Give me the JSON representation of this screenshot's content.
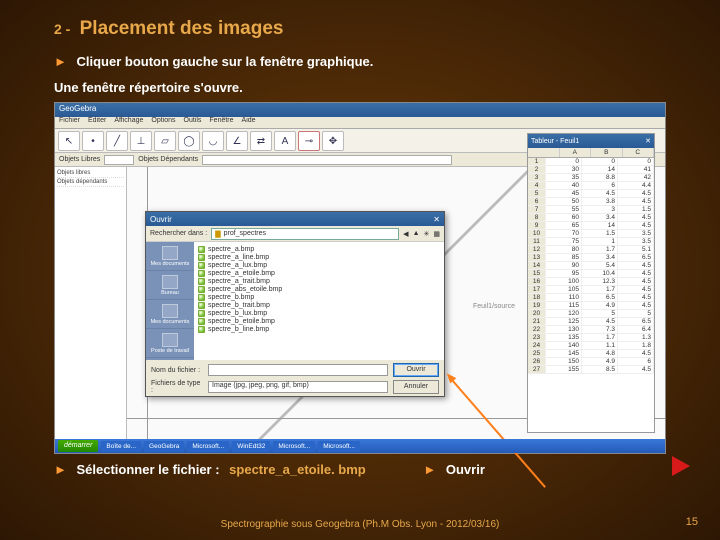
{
  "title": {
    "num": "2 -",
    "text": "Placement des images"
  },
  "bullets": {
    "b1": "Cliquer bouton gauche sur la fenêtre graphique.",
    "b2": "Une fenêtre répertoire s'ouvre."
  },
  "app": {
    "winTitle": "GeoGebra",
    "menus": [
      "Fichier",
      "Éditer",
      "Affichage",
      "Options",
      "Outils",
      "Fenêtre",
      "Aide"
    ],
    "fieldLabel1": "Objets Libres",
    "fieldLabel2": "Objets Dépendants",
    "leftList": [
      "Objets libres",
      "Objets dépendants"
    ],
    "fileCaption": "Feuil1/source"
  },
  "dialog": {
    "title": "Ouvrir",
    "locLabel": "Rechercher dans :",
    "locValue": "prof_spectres",
    "places": [
      "Mes documents",
      "Bureau",
      "Mes documents",
      "Poste de travail"
    ],
    "files": [
      "spectre_a.bmp",
      "spectre_a_line.bmp",
      "spectre_a_lux.bmp",
      "spectre_a_etoile.bmp",
      "spectre_a_trait.bmp",
      "spectre_abs_etoile.bmp",
      "spectre_b.bmp",
      "spectre_b_trait.bmp",
      "spectre_b_lux.bmp",
      "spectre_b_etoile.bmp",
      "spectre_b_line.bmp"
    ],
    "nameLabel": "Nom du fichier :",
    "typeLabel": "Fichiers de type :",
    "typeValue": "Image (jpg, jpeg, png, gif, bmp)",
    "openBtn": "Ouvrir",
    "cancelBtn": "Annuler"
  },
  "sheet": {
    "title": "Tableur - Feuil1",
    "cols": [
      "",
      "A",
      "B",
      "C"
    ],
    "rows": [
      [
        "1",
        "0",
        "0",
        "0"
      ],
      [
        "2",
        "30",
        "14",
        "41"
      ],
      [
        "3",
        "35",
        "8.8",
        "42"
      ],
      [
        "4",
        "40",
        "6",
        "4.4"
      ],
      [
        "5",
        "45",
        "4.5",
        "4.5"
      ],
      [
        "6",
        "50",
        "3.8",
        "4.5"
      ],
      [
        "7",
        "55",
        "3",
        "1.5"
      ],
      [
        "8",
        "60",
        "3.4",
        "4.5"
      ],
      [
        "9",
        "65",
        "14",
        "4.5"
      ],
      [
        "10",
        "70",
        "1.5",
        "3.5"
      ],
      [
        "11",
        "75",
        "1",
        "3.5"
      ],
      [
        "12",
        "80",
        "1.7",
        "5.1"
      ],
      [
        "13",
        "85",
        "3.4",
        "6.5"
      ],
      [
        "14",
        "90",
        "5.4",
        "4.5"
      ],
      [
        "15",
        "95",
        "10.4",
        "4.5"
      ],
      [
        "16",
        "100",
        "12.3",
        "4.5"
      ],
      [
        "17",
        "105",
        "1.7",
        "4.5"
      ],
      [
        "18",
        "110",
        "6.5",
        "4.5"
      ],
      [
        "19",
        "115",
        "4.9",
        "4.5"
      ],
      [
        "20",
        "120",
        "5",
        "5"
      ],
      [
        "21",
        "125",
        "4.5",
        "6.5"
      ],
      [
        "22",
        "130",
        "7.3",
        "6.4"
      ],
      [
        "23",
        "135",
        "1.7",
        "1.3"
      ],
      [
        "24",
        "140",
        "1.1",
        "1.8"
      ],
      [
        "25",
        "145",
        "4.8",
        "4.5"
      ],
      [
        "26",
        "150",
        "4.9",
        "6"
      ],
      [
        "27",
        "155",
        "8.5",
        "4.5"
      ]
    ]
  },
  "taskbar": {
    "start": "démarrer",
    "items": [
      "Boîte de...",
      "GeoGebra",
      "Microsoft...",
      "WinEdt32",
      "Microsoft...",
      "Microsoft..."
    ]
  },
  "bottom": {
    "selLabel": "Sélectionner le fichier :",
    "filename": "spectre_a_etoile. bmp",
    "ouvrir": "Ouvrir"
  },
  "footer": "Spectrographie sous Geogebra (Ph.M Obs. Lyon - 2012/03/16)",
  "pageNum": "15"
}
